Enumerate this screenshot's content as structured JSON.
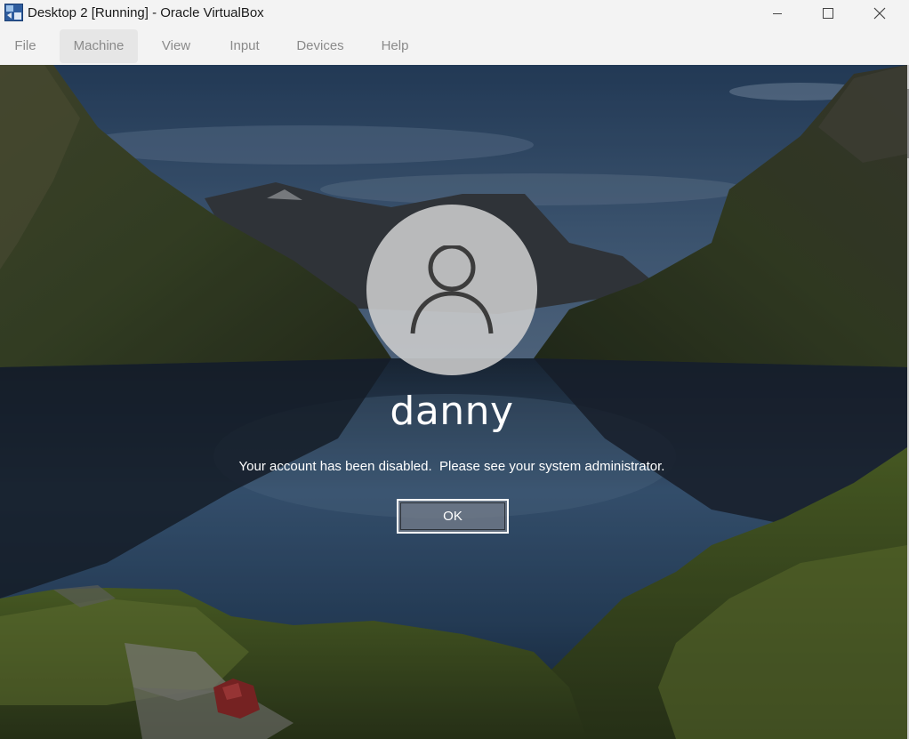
{
  "window": {
    "title": "Desktop 2 [Running] - Oracle VirtualBox",
    "icon": "virtualbox-app-icon",
    "controls": {
      "minimize_icon": "minimize-icon",
      "maximize_icon": "maximize-icon",
      "close_icon": "close-icon"
    }
  },
  "menu": {
    "items": [
      {
        "label": "File"
      },
      {
        "label": "Machine",
        "active": true
      },
      {
        "label": "View"
      },
      {
        "label": "Input"
      },
      {
        "label": "Devices"
      },
      {
        "label": "Help"
      }
    ]
  },
  "lock_screen": {
    "avatar_icon": "user-icon",
    "username": "danny",
    "message": "Your account has been disabled.  Please see your system administrator.",
    "ok_label": "OK"
  },
  "colors": {
    "titlebar_bg": "#f3f3f3",
    "menu_active_bg": "#e6e6e6",
    "avatar_bg": "#cdcdcd",
    "button_border": "#ffffff"
  }
}
